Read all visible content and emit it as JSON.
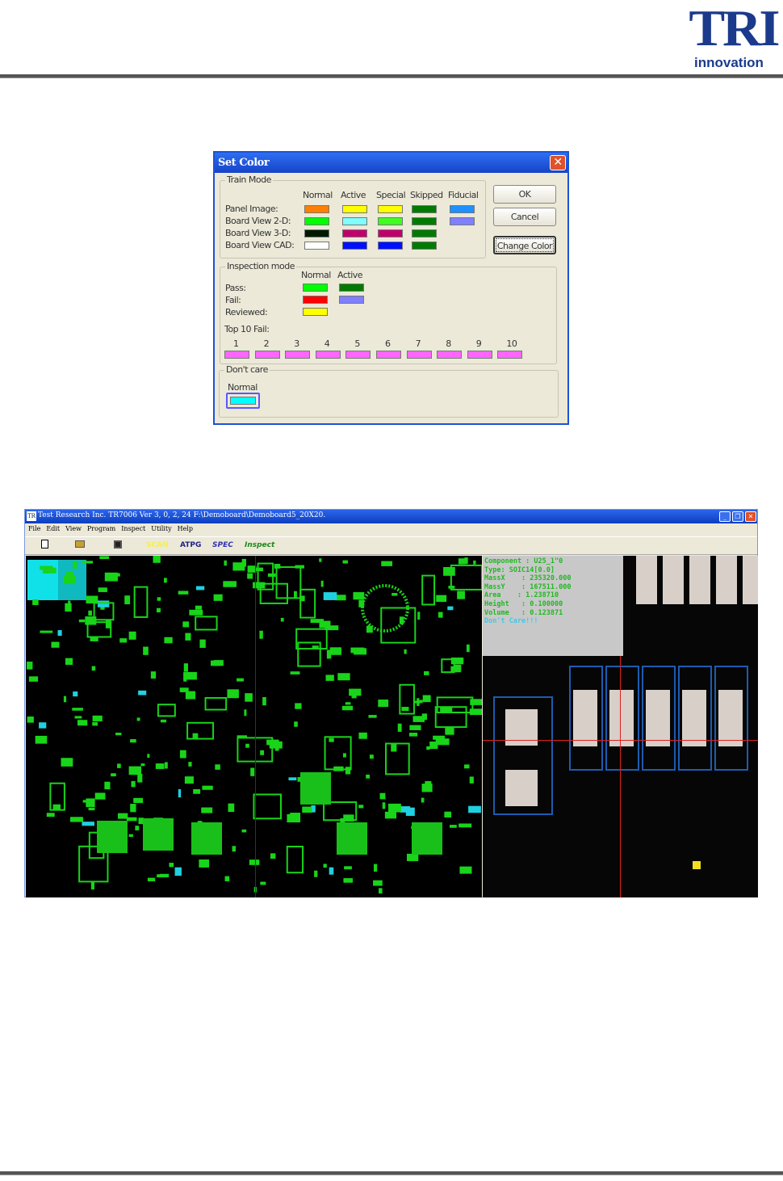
{
  "header": {
    "logo_text": "TRI",
    "logo_subtext": "innovation"
  },
  "set_color_dialog": {
    "title": "Set Color",
    "close_icon": "close-icon",
    "train_mode": {
      "label": "Train Mode",
      "columns": [
        "Normal",
        "Active",
        "Special",
        "Skipped",
        "Fiducial"
      ],
      "rows": [
        {
          "label": "Panel Image:",
          "colors": [
            "#ff7f00",
            "#ffff00",
            "#ffff00",
            "#007a00",
            "#1e90ff"
          ]
        },
        {
          "label": "Board View 2-D:",
          "colors": [
            "#00ff00",
            "#80ffff",
            "#40ff20",
            "#007a00",
            "#8080ff"
          ]
        },
        {
          "label": "Board View 3-D:",
          "colors": [
            "#001a00",
            "#c0006a",
            "#c0006a",
            "#007a00",
            null
          ]
        },
        {
          "label": "Board View CAD:",
          "colors": [
            "#ffffff",
            "#0010ff",
            "#0010ff",
            "#007a00",
            null
          ]
        }
      ]
    },
    "buttons": {
      "ok": "OK",
      "cancel": "Cancel",
      "change_color": "Change Color"
    },
    "inspection_mode": {
      "label": "Inspection mode",
      "columns": [
        "Normal",
        "Active"
      ],
      "rows": [
        {
          "label": "Pass:",
          "colors": [
            "#00ff00",
            "#007a00"
          ]
        },
        {
          "label": "Fail:",
          "colors": [
            "#ff0000",
            "#8080ff"
          ]
        },
        {
          "label": "Reviewed:",
          "colors": [
            "#ffff00",
            null
          ]
        }
      ],
      "top10_label": "Top 10 Fail:",
      "top10": [
        "1",
        "2",
        "3",
        "4",
        "5",
        "6",
        "7",
        "8",
        "9",
        "10"
      ],
      "top10_color": "#ff66ff"
    },
    "dont_care": {
      "label": "Don't care",
      "column": "Normal",
      "color": "#00ffff"
    }
  },
  "app_window": {
    "title": "Test Research Inc. TR7006 Ver 3, 0, 2, 24    F:\\Demoboard\\Demoboard5_20X20.",
    "menu": [
      "File",
      "Edit",
      "View",
      "Program",
      "Inspect",
      "Utility",
      "Help"
    ],
    "toolbar": {
      "new_icon": "new-file-icon",
      "open_icon": "open-folder-icon",
      "save_icon": "save-icon",
      "scan": "SCAN",
      "atpg": "ATPG",
      "spec": "SPEC",
      "inspect": "Inspect"
    },
    "info_panel": [
      "Component : U25_1\"0",
      "Type: SOIC14[0.0]",
      "MassX    : 235320.000",
      "MassY    : 167511.000",
      "Area    : 1.238710",
      "Height   : 0.100000",
      "Volume   : 0.123871",
      "Don't Care!!!"
    ]
  }
}
